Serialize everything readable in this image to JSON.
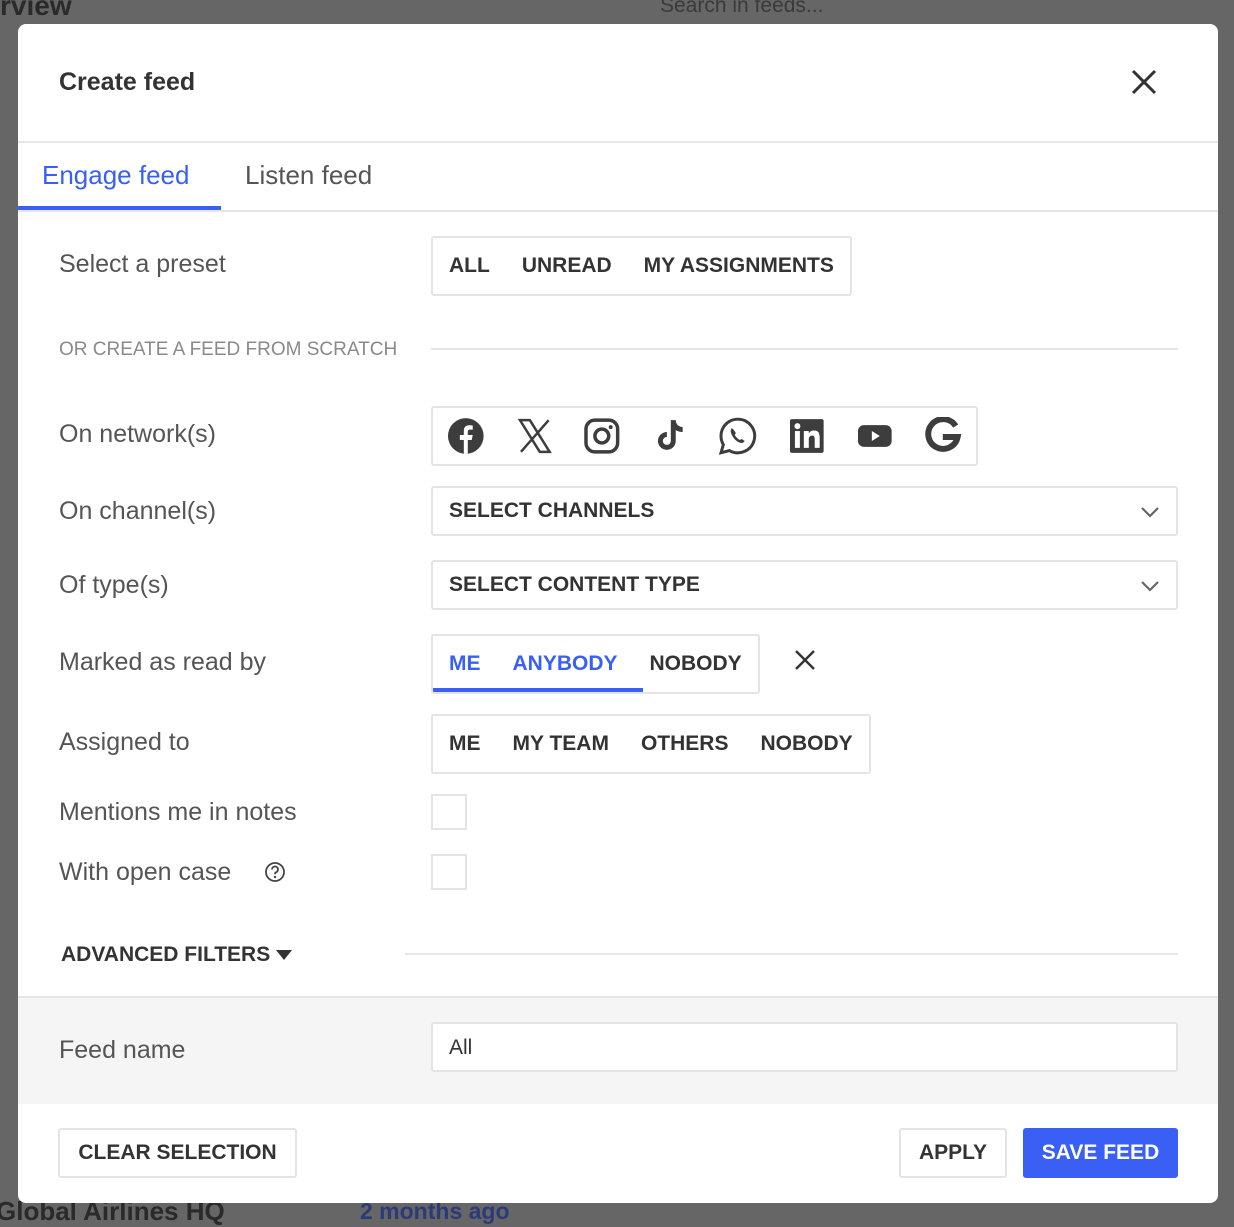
{
  "background": {
    "title_fragment": "rview",
    "search_placeholder": "Search in feeds...",
    "bottom_name": "Global Airlines HQ",
    "bottom_time": "2 months ago"
  },
  "modal": {
    "title": "Create feed",
    "tabs": [
      {
        "label": "Engage feed",
        "active": true
      },
      {
        "label": "Listen feed",
        "active": false
      }
    ],
    "preset": {
      "label": "Select a preset",
      "options": [
        "ALL",
        "UNREAD",
        "MY ASSIGNMENTS"
      ]
    },
    "scratch_divider": "OR CREATE A FEED FROM SCRATCH",
    "networks": {
      "label": "On network(s)",
      "icons": [
        "facebook-icon",
        "x-icon",
        "instagram-icon",
        "tiktok-icon",
        "whatsapp-icon",
        "linkedin-icon",
        "youtube-icon",
        "google-icon"
      ]
    },
    "channels": {
      "label": "On channel(s)",
      "value": "SELECT CHANNELS"
    },
    "types": {
      "label": "Of type(s)",
      "value": "SELECT CONTENT TYPE"
    },
    "read_by": {
      "label": "Marked as read by",
      "options": [
        "ME",
        "ANYBODY",
        "NOBODY"
      ],
      "selected": [
        "ME",
        "ANYBODY"
      ]
    },
    "assigned": {
      "label": "Assigned to",
      "options": [
        "ME",
        "MY TEAM",
        "OTHERS",
        "NOBODY"
      ]
    },
    "mentions": {
      "label": "Mentions me in notes",
      "checked": false
    },
    "open_case": {
      "label": "With open case",
      "checked": false
    },
    "advanced": "ADVANCED FILTERS",
    "feed_name": {
      "label": "Feed name",
      "value": "All"
    },
    "buttons": {
      "clear": "CLEAR SELECTION",
      "apply": "APPLY",
      "save": "SAVE FEED"
    }
  },
  "colors": {
    "accent": "#3a5ff5",
    "text": "#3d3d3d",
    "border": "#e4e4e4"
  }
}
